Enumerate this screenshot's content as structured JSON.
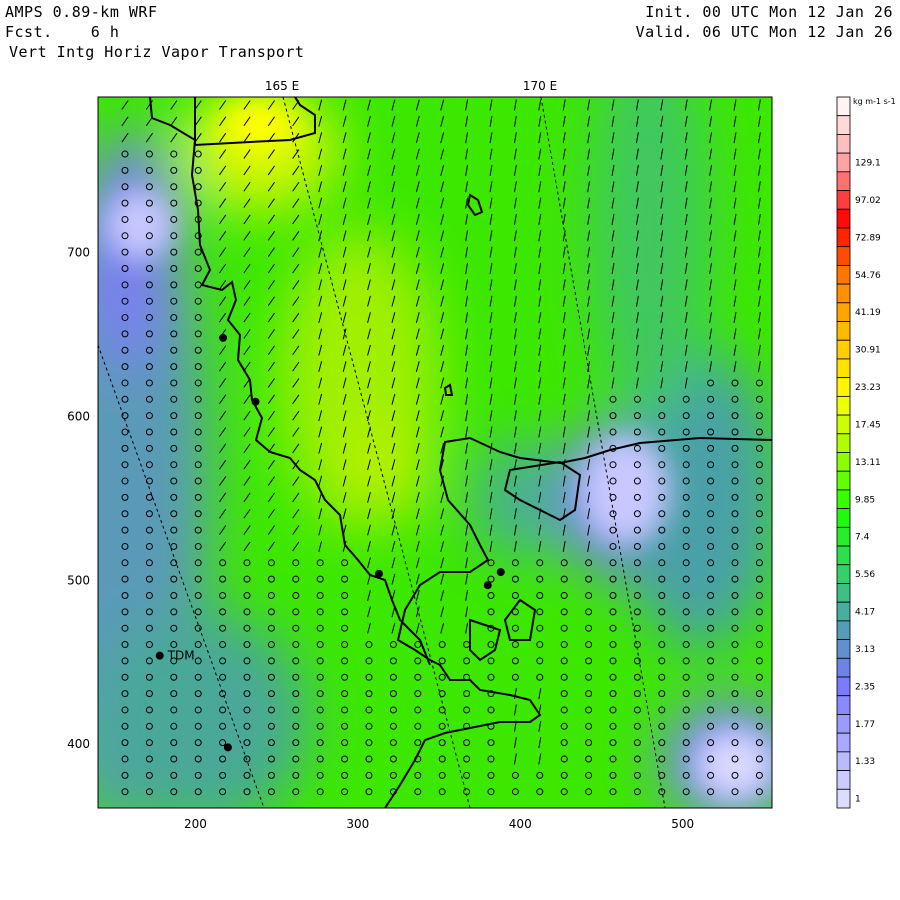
{
  "header": {
    "model": "AMPS 0.89-km WRF",
    "forecast": "Fcst.    6 h",
    "field": "Vert Intg Horiz Vapor Transport",
    "init": "Init. 00 UTC Mon 12 Jan 26",
    "valid": "Valid. 06 UTC Mon 12 Jan 26"
  },
  "map": {
    "meridian_labels": [
      "165 E",
      "170 E"
    ],
    "x_ticks": [
      "200",
      "300",
      "400",
      "500"
    ],
    "y_ticks": [
      "700",
      "600",
      "500",
      "400"
    ],
    "x_range": [
      140,
      555
    ],
    "y_range": [
      361,
      795
    ],
    "stations": [
      {
        "label": "TDM",
        "x": 178,
        "y": 454
      }
    ],
    "unlabeled_station_points": [
      [
        217,
        648
      ],
      [
        237,
        609
      ],
      [
        313,
        504
      ],
      [
        388,
        505
      ],
      [
        380,
        497
      ],
      [
        220,
        398
      ]
    ]
  },
  "colorbar": {
    "units": "kg m-1 s-1",
    "labels": [
      "129.1",
      "97.02",
      "72.89",
      "54.76",
      "41.19",
      "30.91",
      "23.23",
      "17.45",
      "13.11",
      "9.85",
      "7.4",
      "5.56",
      "4.17",
      "3.13",
      "2.35",
      "1.77",
      "1.33",
      "1"
    ],
    "stop_colors": [
      "#fff4f4",
      "#ffa0a0",
      "#ff0000",
      "#ff8000",
      "#ffc000",
      "#ffff00",
      "#a0ff00",
      "#20ff00",
      "#30d860",
      "#50a0b0",
      "#7878ff",
      "#a8a8ff",
      "#dcdcff"
    ]
  }
}
